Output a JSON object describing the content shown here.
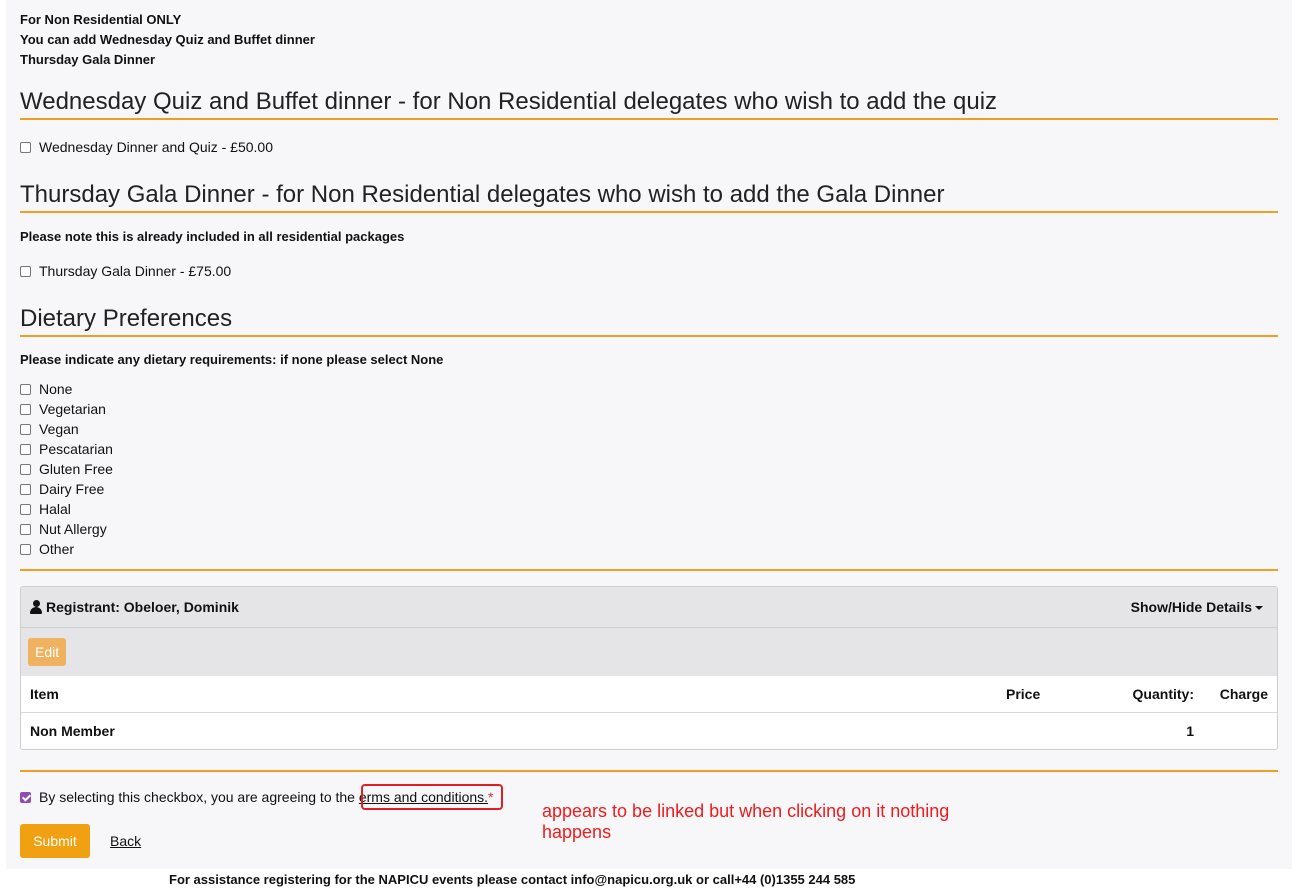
{
  "intro": {
    "line1": "For Non Residential ONLY",
    "line2": "You can add Wednesday Quiz and Buffet dinner",
    "line3": "Thursday Gala Dinner"
  },
  "wednesday": {
    "heading": "Wednesday Quiz and Buffet dinner - for Non Residential delegates who wish to add the quiz",
    "option": "Wednesday Dinner and Quiz - £50.00"
  },
  "thursday": {
    "heading": "Thursday Gala Dinner - for Non Residential delegates who wish to add the Gala Dinner",
    "note": "Please note this is already included in all residential packages",
    "option": "Thursday Gala Dinner - £75.00"
  },
  "dietary": {
    "heading": "Dietary Preferences",
    "note": "Please indicate any dietary requirements: if none please select None",
    "options": [
      "None",
      "Vegetarian",
      "Vegan",
      "Pescatarian",
      "Gluten Free",
      "Dairy Free",
      "Halal",
      "Nut Allergy",
      "Other"
    ]
  },
  "registrant": {
    "label": "Registrant: Obeloer, Dominik",
    "toggle": "Show/Hide Details",
    "edit": "Edit",
    "columns": {
      "item": "Item",
      "price": "Price",
      "quantity": "Quantity:",
      "charge": "Charge"
    },
    "row": {
      "item": "Non Member",
      "price": "",
      "quantity": "1",
      "charge": ""
    }
  },
  "terms": {
    "prefix": "By selecting this checkbox, you are agreeing to the ",
    "link": "erms and conditions.",
    "required": "*",
    "checked": true
  },
  "annotation": "appears to be linked but when clicking on it nothing happens",
  "actions": {
    "submit": "Submit",
    "back": "Back"
  },
  "footer": "For assistance registering for the NAPICU events please contact info@napicu.org.uk or call+44 (0)1355 244 585",
  "colors": {
    "accent": "#f0a020",
    "annotation": "#ee1c1c",
    "checkbox_checked": "#8e4bb8"
  }
}
